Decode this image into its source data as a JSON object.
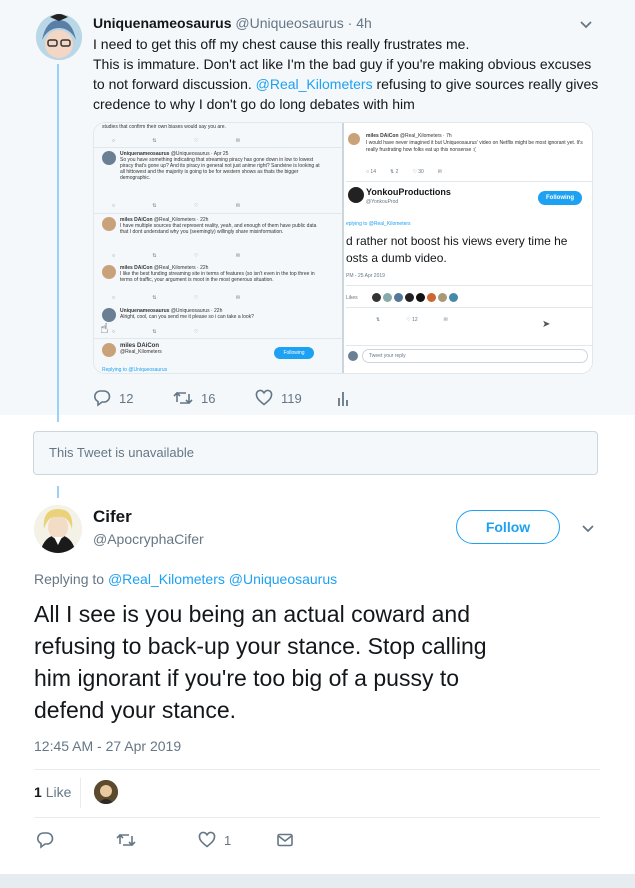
{
  "parent_tweet": {
    "name": "Uniquenameosaurus",
    "handle": "@Uniqueosaurus",
    "age": "· 4h",
    "lines": [
      "I need to get this off my chest cause this really frustrates me.",
      "This is immature. Don't act like I'm the bad guy if you're making obvious excuses",
      "to not forward discussion. ",
      "credence to why I don't go do long debates with him"
    ],
    "mention": "@Real_Kilometers",
    "line3_rest": " refusing to give sources really gives",
    "replies": "12",
    "retweets": "16",
    "likes": "119",
    "media": {
      "left": {
        "top_text": "studies that confirm their own biases would say you are.",
        "t1_name": "Uniquenameosaurus",
        "t1_meta": "@Uniqueosaurus · Apr 25",
        "t1_text": "So you have something indicating that streaming piracy has gone down in low to lowest piracy that's gone up? And its piracy in general not just anime right? Sandvine is looking at all hittowest and the majority is going to be for western shows as thats the bigger demographic.",
        "t2_name": "miles DAiCon",
        "t2_meta": "@Real_Kilometers · 22h",
        "t2_text": "I have multiple sources that represent reality, yeah, and enough of them have public data that I dont understand why you (seemingly) willingly share misinformation.",
        "t3_name": "miles DAiCon",
        "t3_meta": "@Real_Kilometers · 22h",
        "t3_text": "I like the best funding streaming site in terms of features (so isn't even in the top three in terms of traffic, your argument is moot in the most generous situation.",
        "t4_name": "Uniquenameosaurus",
        "t4_meta": "@Uniqueosaurus · 22h",
        "t4_text": "Alright, cool, can you send me it please so i can take a look?",
        "t5_name": "miles DAiCon",
        "t5_handle": "@Real_Kilometers",
        "follow": "Following",
        "replying": "Replying to @Uniqueosaurus"
      },
      "right": {
        "r1_name": "miles DAiCon",
        "r1_meta": "@Real_Kilometers · 7h",
        "r1_text": "I would have never imagined it but Uniqueosaurus' video on Netflix might be most ignorant yet. It's really frustrating how folks eat up this nonsense :(",
        "r1_counts": [
          "14",
          "2",
          "30"
        ],
        "r2_name": "YonkouProductions",
        "r2_handle": "@YonkouProd",
        "follow": "Following",
        "replying": "eplying to @Real_Kilometers",
        "big_text_1": "d rather not boost his views every time he",
        "big_text_2": "osts a dumb video.",
        "date": "PM - 25 Apr 2019",
        "likes_label": "Likes",
        "reply_count": "12",
        "reply_placeholder": "Tweet your reply"
      }
    }
  },
  "unavailable": "This Tweet is unavailable",
  "main_tweet": {
    "name": "Cifer",
    "handle": "@ApocryphaCifer",
    "follow": "Follow",
    "replying_prefix": "Replying to ",
    "replying_to": "@Real_Kilometers @Uniqueosaurus",
    "lines": [
      "All I see is you being an actual coward and",
      "refusing to back-up your stance. Stop calling",
      "him ignorant if you're too big of a pussy to",
      "defend your stance."
    ],
    "timestamp": "12:45 AM - 27 Apr 2019",
    "likes_count": "1",
    "likes_label": "Like",
    "action_likes": "1"
  },
  "icons": [
    "more-chevron-icon",
    "reply-icon",
    "retweet-icon",
    "like-icon",
    "analytics-icon",
    "dm-icon"
  ],
  "colors": {
    "accent": "#1da1f2",
    "muted": "#657786",
    "thread": "#9bd1f9",
    "bg_parent": "#f5f8fa"
  }
}
